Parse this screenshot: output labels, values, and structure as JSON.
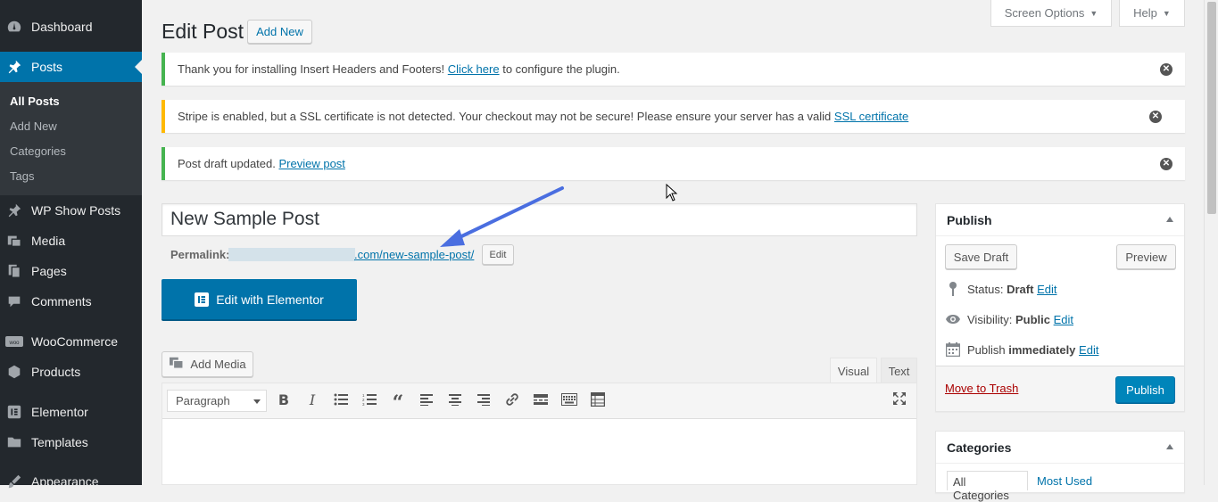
{
  "menu": {
    "dashboard": "Dashboard",
    "posts": "Posts",
    "sub": {
      "all_posts": "All Posts",
      "add_new": "Add New",
      "categories": "Categories",
      "tags": "Tags"
    },
    "wp_show_posts": "WP Show Posts",
    "media": "Media",
    "pages": "Pages",
    "comments": "Comments",
    "woocommerce": "WooCommerce",
    "products": "Products",
    "elementor": "Elementor",
    "templates": "Templates",
    "appearance": "Appearance"
  },
  "topbar": {
    "screen_options": "Screen Options",
    "help": "Help"
  },
  "header": {
    "title": "Edit Post",
    "add_new": "Add New"
  },
  "notices": {
    "n1_text": "Thank you for installing Insert Headers and Footers!",
    "n1_link": "Click here",
    "n1_after": "to configure the plugin.",
    "n2_text": "Stripe is enabled, but a SSL certificate is not detected. Your checkout may not be secure! Please ensure your server has a valid",
    "n2_link": "SSL certificate",
    "n3_text": "Post draft updated.",
    "n3_link": "Preview post"
  },
  "post": {
    "title": "New Sample Post",
    "permalink_label": "Permalink:",
    "permalink_slug": ".com/new-sample-post/",
    "permalink_edit": "Edit"
  },
  "elementor": {
    "button": "Edit with Elementor"
  },
  "editor": {
    "add_media": "Add Media",
    "tab_visual": "Visual",
    "tab_text": "Text",
    "format": "Paragraph"
  },
  "publish": {
    "title": "Publish",
    "save_draft": "Save Draft",
    "preview": "Preview",
    "status_label": "Status:",
    "status_value": "Draft",
    "visibility_label": "Visibility:",
    "visibility_value": "Public",
    "schedule_label": "Publish",
    "schedule_value": "immediately",
    "edit": "Edit",
    "trash": "Move to Trash",
    "publish_btn": "Publish"
  },
  "categories": {
    "title": "Categories",
    "tab_all": "All Categories",
    "tab_most": "Most Used"
  },
  "colors": {
    "accent": "#0073aa",
    "sidebar": "#23282d",
    "success": "#46b450",
    "warning": "#ffb900",
    "arrow": "#4a6ee0"
  }
}
